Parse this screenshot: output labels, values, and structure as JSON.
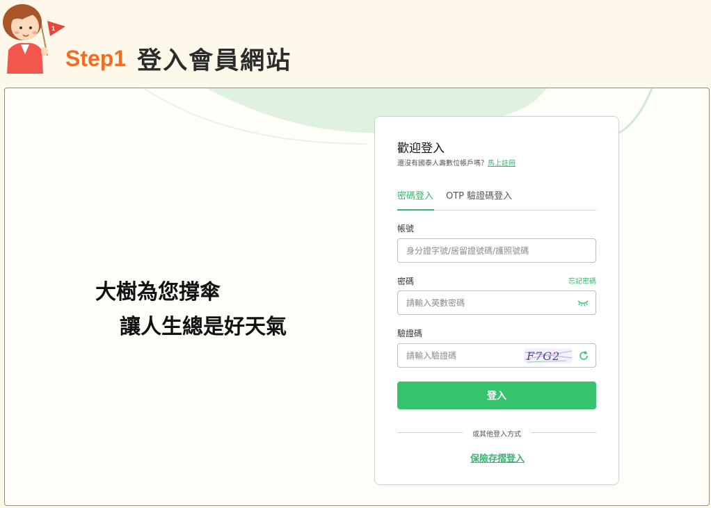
{
  "header": {
    "step_label": "Step1",
    "step_text": "登入會員網站",
    "flag_number": "1",
    "accent_color": "#f36c21"
  },
  "slogan": {
    "line1": "大樹為您撐傘",
    "line2": "讓人生總是好天氣"
  },
  "login_card": {
    "welcome": "歡迎登入",
    "signup_prompt": "還沒有國泰人壽數位帳戶嗎？",
    "signup_link": "馬上註冊",
    "tabs": [
      {
        "label": "密碼登入",
        "active": true
      },
      {
        "label": "OTP 驗證碼登入",
        "active": false
      }
    ],
    "account_label": "帳號",
    "account_placeholder": "身分證字號/居留證號碼/護照號碼",
    "password_label": "密碼",
    "forgot_password": "忘記密碼",
    "password_placeholder": "請輸入英數密碼",
    "captcha_label": "驗證碼",
    "captcha_placeholder": "請輸入驗證碼",
    "captcha_text": "F7G2",
    "login_button": "登入",
    "other_methods": "或其他登入方式",
    "alt_login": "保險存摺登入",
    "accent_color": "#36c36b",
    "icons": [
      "eye-closed-icon",
      "refresh-icon"
    ]
  }
}
